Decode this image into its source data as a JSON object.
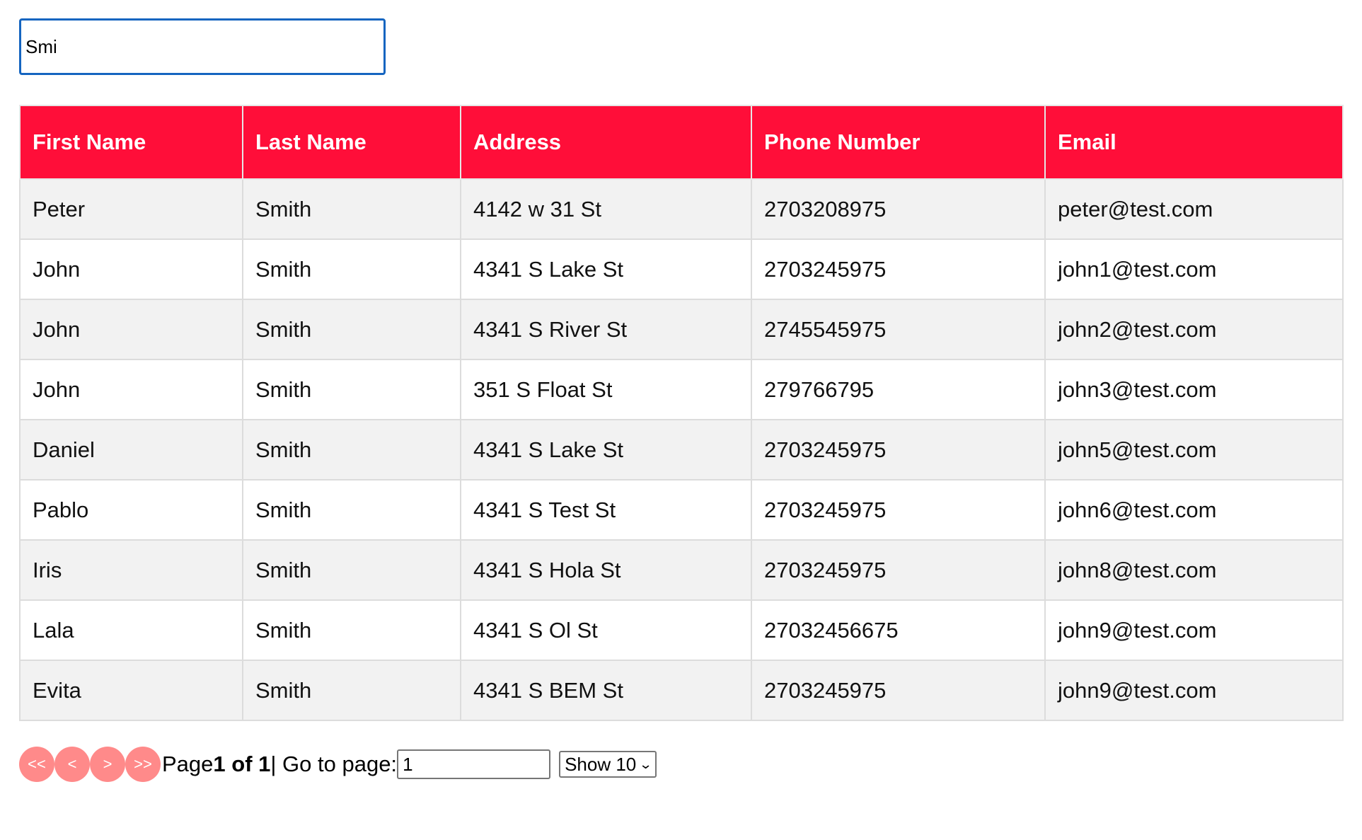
{
  "search": {
    "value": "Smi"
  },
  "colors": {
    "header_bg": "#ff0e39",
    "pager_button_bg": "#ff8a8a",
    "search_border": "#1565c0"
  },
  "table": {
    "columns": [
      "First Name",
      "Last Name",
      "Address",
      "Phone Number",
      "Email"
    ],
    "rows": [
      [
        "Peter",
        "Smith",
        "4142 w 31 St",
        "2703208975",
        "peter@test.com"
      ],
      [
        "John",
        "Smith",
        "4341 S Lake St",
        "2703245975",
        "john1@test.com"
      ],
      [
        "John",
        "Smith",
        "4341 S River St",
        "2745545975",
        "john2@test.com"
      ],
      [
        "John",
        "Smith",
        "351 S Float St",
        "279766795",
        "john3@test.com"
      ],
      [
        "Daniel",
        "Smith",
        "4341 S Lake St",
        "2703245975",
        "john5@test.com"
      ],
      [
        "Pablo",
        "Smith",
        "4341 S Test St",
        "2703245975",
        "john6@test.com"
      ],
      [
        "Iris",
        "Smith",
        "4341 S Hola St",
        "2703245975",
        "john8@test.com"
      ],
      [
        "Lala",
        "Smith",
        "4341 S Ol St",
        "27032456675",
        "john9@test.com"
      ],
      [
        "Evita",
        "Smith",
        "4341 S BEM St",
        "2703245975",
        "john9@test.com"
      ]
    ]
  },
  "pagination": {
    "first_label": "<<",
    "prev_label": "<",
    "next_label": ">",
    "last_label": ">>",
    "page_prefix": "Page",
    "page_status": "1 of 1",
    "goto_label": "| Go to page:",
    "goto_value": "1",
    "show_label": "Show 10",
    "chevron_icon": "chevron-down-icon"
  }
}
